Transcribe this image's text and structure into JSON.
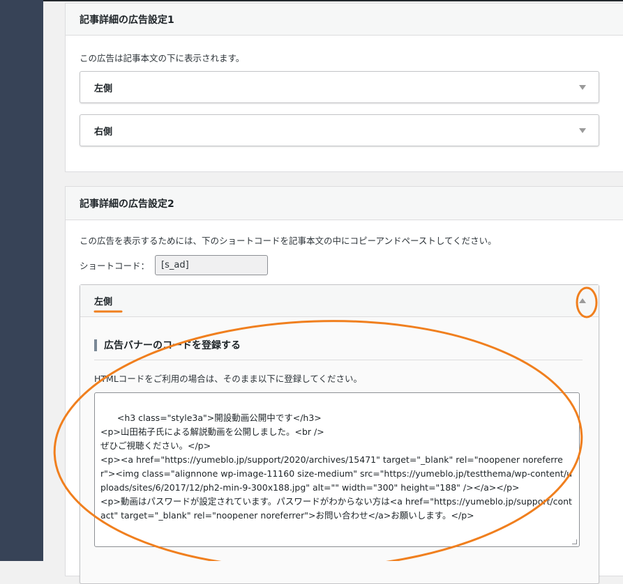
{
  "panel1": {
    "title": "記事詳細の広告設定1",
    "description": "この広告は記事本文の下に表示されます。",
    "accordions": [
      {
        "label": "左側"
      },
      {
        "label": "右側"
      }
    ]
  },
  "panel2": {
    "title": "記事詳細の広告設定2",
    "description": "この広告を表示するためには、下のショートコードを記事本文の中にコピーアンドペーストしてください。",
    "shortcode_label": "ショートコード：",
    "shortcode_value": "[s_ad]",
    "open_accordion": {
      "label": "左側",
      "section_title": "広告バナーのコードを登録する",
      "html_description": "HTMLコードをご利用の場合は、そのまま以下に登録してください。",
      "code": "<h3 class=\"style3a\">開設動画公開中です</h3>\n<p>山田祐子氏による解説動画を公開しました。<br />\nぜひご視聴ください。</p>\n<p><a href=\"https://yumeblo.jp/support/2020/archives/15471\" target=\"_blank\" rel=\"noopener noreferrer\"><img class=\"alignnone wp-image-11160 size-medium\" src=\"https://yumeblo.jp/testthema/wp-content/uploads/sites/6/2017/12/ph2-min-9-300x188.jpg\" alt=\"\" width=\"300\" height=\"188\" /></a></p>\n<p>動画はパスワードが設定されています。パスワードがわからない方は<a href=\"https://yumeblo.jp/support/contact\" target=\"_blank\" rel=\"noopener noreferrer\">お問い合わせ</a>お願いします。</p>"
    }
  },
  "colors": {
    "sidebar": "#374357",
    "annotation": "#f07f1e"
  }
}
